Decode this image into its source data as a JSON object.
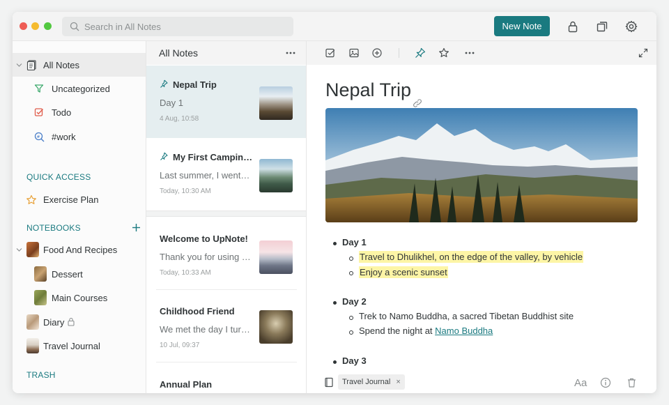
{
  "search": {
    "placeholder": "Search in All Notes"
  },
  "toolbar": {
    "new_note_label": "New Note"
  },
  "sidebar": {
    "items": [
      {
        "label": "All Notes"
      },
      {
        "label": "Uncategorized"
      },
      {
        "label": "Todo"
      },
      {
        "label": "#work"
      }
    ],
    "quick_access_title": "QUICK ACCESS",
    "quick_access": [
      {
        "label": "Exercise Plan"
      }
    ],
    "notebooks_title": "NOTEBOOKS",
    "notebooks": [
      {
        "label": "Food And Recipes"
      },
      {
        "label": "Dessert"
      },
      {
        "label": "Main Courses"
      },
      {
        "label": "Diary"
      },
      {
        "label": "Travel Journal"
      }
    ],
    "trash_label": "TRASH"
  },
  "notelist": {
    "title": "All Notes",
    "notes": [
      {
        "title": "Nepal Trip",
        "snippet": "Day 1",
        "date": "4 Aug, 10:58"
      },
      {
        "title": "My First Camping Trip",
        "snippet": "Last summer, I went camping",
        "date": "Today, 10:30 AM"
      },
      {
        "title": "Welcome to UpNote!",
        "snippet": "Thank you for using UpNote",
        "date": "Today, 10:33 AM"
      },
      {
        "title": "Childhood Friend",
        "snippet": "We met the day I turned five",
        "date": "10 Jul, 09:37"
      },
      {
        "title": "Annual Plan",
        "snippet": "",
        "date": ""
      }
    ]
  },
  "editor": {
    "title": "Nepal Trip",
    "days": [
      {
        "label": "Day 1",
        "items": [
          "Travel to Dhulikhel, on the edge of the valley, by vehicle",
          "Enjoy a scenic sunset"
        ]
      },
      {
        "label": "Day 2",
        "items": [
          "Trek to Namo Buddha, a sacred Tibetan Buddhist site"
        ],
        "night_prefix": "Spend the night at ",
        "night_link": "Namo Buddha"
      },
      {
        "label": "Day 3",
        "items": []
      }
    ],
    "tag": "Travel Journal",
    "font_button": "Aa"
  },
  "colors": {
    "accent": "#1a7a80",
    "highlight": "#fdf5a6"
  }
}
